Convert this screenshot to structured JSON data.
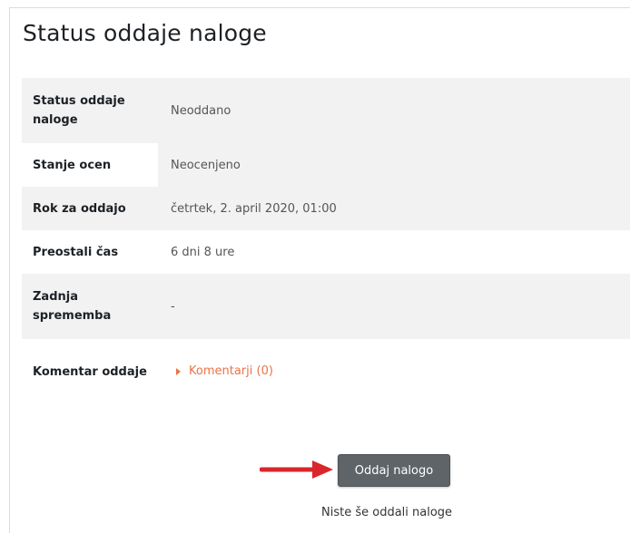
{
  "page": {
    "title": "Status oddaje naloge"
  },
  "status_table": {
    "rows": [
      {
        "label": "Status oddaje naloge",
        "value": "Neoddano"
      },
      {
        "label": "Stanje ocen",
        "value": "Neocenjeno"
      },
      {
        "label": "Rok za oddajo",
        "value": "četrtek, 2. april 2020, 01:00"
      },
      {
        "label": "Preostali čas",
        "value": "6 dni 8 ure"
      },
      {
        "label": "Zadnja sprememba",
        "value": "-"
      },
      {
        "label": "Komentar oddaje",
        "value": ""
      }
    ],
    "comments_link": "Komentarji (0)"
  },
  "actions": {
    "submit_label": "Oddaj nalogo",
    "note": "Niste še oddali naloge"
  },
  "colors": {
    "link": "#e8744a",
    "button": "#5f6469",
    "arrow": "#d9262b",
    "row_shade": "#f2f2f2"
  },
  "icons": {
    "comments_toggle": "triangle-right-icon",
    "pointer": "red-arrow-icon"
  }
}
